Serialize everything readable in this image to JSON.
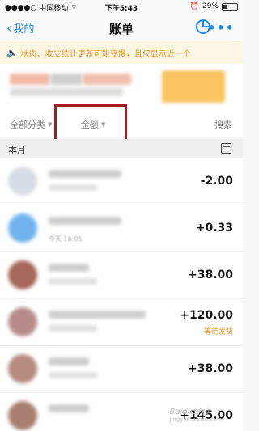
{
  "status_bar": {
    "carrier": "中国移动",
    "time": "下午5:43",
    "battery": "29%",
    "battery_level": 0.29
  },
  "nav": {
    "back_label": "我的",
    "title": "账单",
    "chart_icon": "clock-chart-icon",
    "more_icon": "more-dots-icon"
  },
  "notice": {
    "text": "状态、收支统计更新可能变慢，且仅显示近一个",
    "color": "#e5972c",
    "background": "#fdf6e3"
  },
  "filters": {
    "all_categories": "全部分类",
    "amount": "金额",
    "search": "搜索"
  },
  "month": {
    "label": "本月"
  },
  "transactions": [
    {
      "amount": "-2.00",
      "status": "",
      "date": ""
    },
    {
      "amount": "+0.33",
      "status": "",
      "date": "今天 16:05"
    },
    {
      "amount": "+38.00",
      "status": "",
      "date": ""
    },
    {
      "amount": "+120.00",
      "status": "等待发货",
      "date": ""
    },
    {
      "amount": "+38.00",
      "status": "",
      "date": ""
    },
    {
      "amount": "+145.00",
      "status": "",
      "date": ""
    }
  ],
  "watermark": {
    "brand": "Baidu经验",
    "url": "jingyan.baidu.com"
  },
  "colors": {
    "accent": "#1a8cf0",
    "highlight_border": "#a31d22",
    "pending": "#e5972c"
  }
}
